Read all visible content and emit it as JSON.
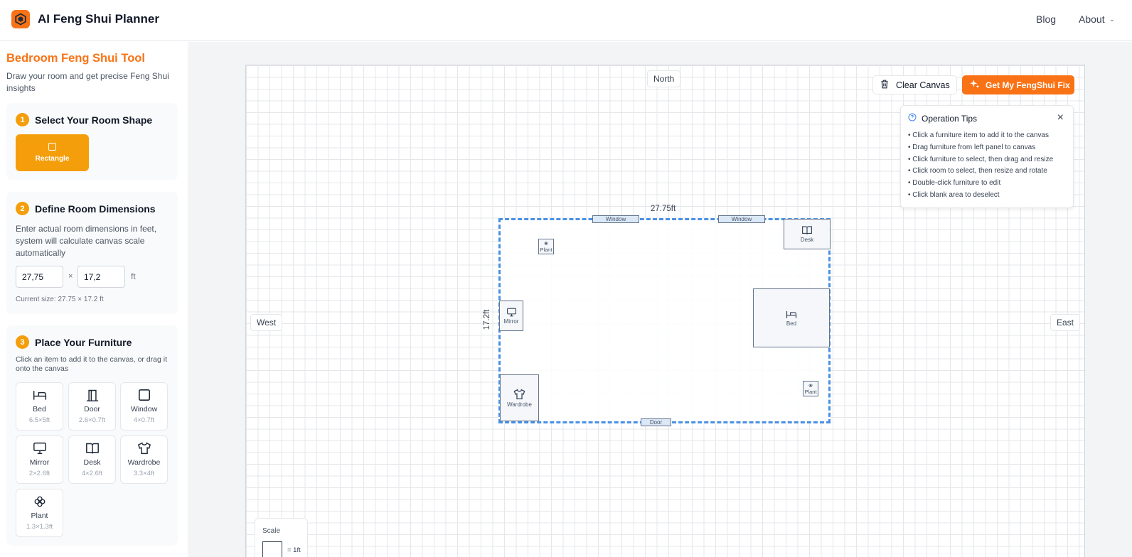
{
  "header": {
    "app_title": "AI Feng Shui Planner",
    "nav": {
      "blog": "Blog",
      "about": "About"
    }
  },
  "sidebar": {
    "title": "Bedroom Feng Shui Tool",
    "description": "Draw your room and get precise Feng Shui insights",
    "step1": {
      "num": "1",
      "title": "Select Your Room Shape",
      "shape_label": "Rectangle"
    },
    "step2": {
      "num": "2",
      "title": "Define Room Dimensions",
      "description": "Enter actual room dimensions in feet, system will calculate canvas scale automatically",
      "width_value": "27,75",
      "length_value": "17,2",
      "times": "×",
      "unit": "ft",
      "current_size": "Current size: 27.75 × 17.2 ft"
    },
    "step3": {
      "num": "3",
      "title": "Place Your Furniture",
      "description": "Click an item to add it to the canvas, or drag it onto the canvas",
      "items": [
        {
          "name": "Bed",
          "size": "6.5×5ft",
          "icon": "bed-icon"
        },
        {
          "name": "Door",
          "size": "2.6×0.7ft",
          "icon": "door-icon"
        },
        {
          "name": "Window",
          "size": "4×0.7ft",
          "icon": "window-icon"
        },
        {
          "name": "Mirror",
          "size": "2×2.6ft",
          "icon": "mirror-icon"
        },
        {
          "name": "Desk",
          "size": "4×2.6ft",
          "icon": "book-icon"
        },
        {
          "name": "Wardrobe",
          "size": "3.3×4ft",
          "icon": "shirt-icon"
        },
        {
          "name": "Plant",
          "size": "1.3×1.3ft",
          "icon": "flower-icon"
        }
      ]
    }
  },
  "canvas": {
    "compass": {
      "north": "North",
      "west": "West",
      "east": "East"
    },
    "clear_label": "Clear Canvas",
    "fix_label": "Get My FengShui Fix",
    "tips": {
      "title": "Operation Tips",
      "close": "×",
      "items": [
        "• Click a furniture item to add it to the canvas",
        "• Drag furniture from left panel to canvas",
        "• Click furniture to select, then drag and resize",
        "• Click room to select, then resize and rotate",
        "• Double-click furniture to edit",
        "• Click blank area to deselect"
      ]
    },
    "room": {
      "width_label": "27.75ft",
      "height_label": "17.2ft",
      "windows": [
        "Window",
        "Window"
      ],
      "door": "Door",
      "plants": [
        "Plant",
        "Plant"
      ],
      "desk": "Desk",
      "mirror": "Mirror",
      "bed": "Bed",
      "wardrobe": "Wardrobe"
    },
    "scale": {
      "label": "Scale",
      "value": "= 1ft"
    }
  },
  "colors": {
    "accent": "#f97316",
    "step": "#f59e0b",
    "room_border": "#4a90e2"
  }
}
